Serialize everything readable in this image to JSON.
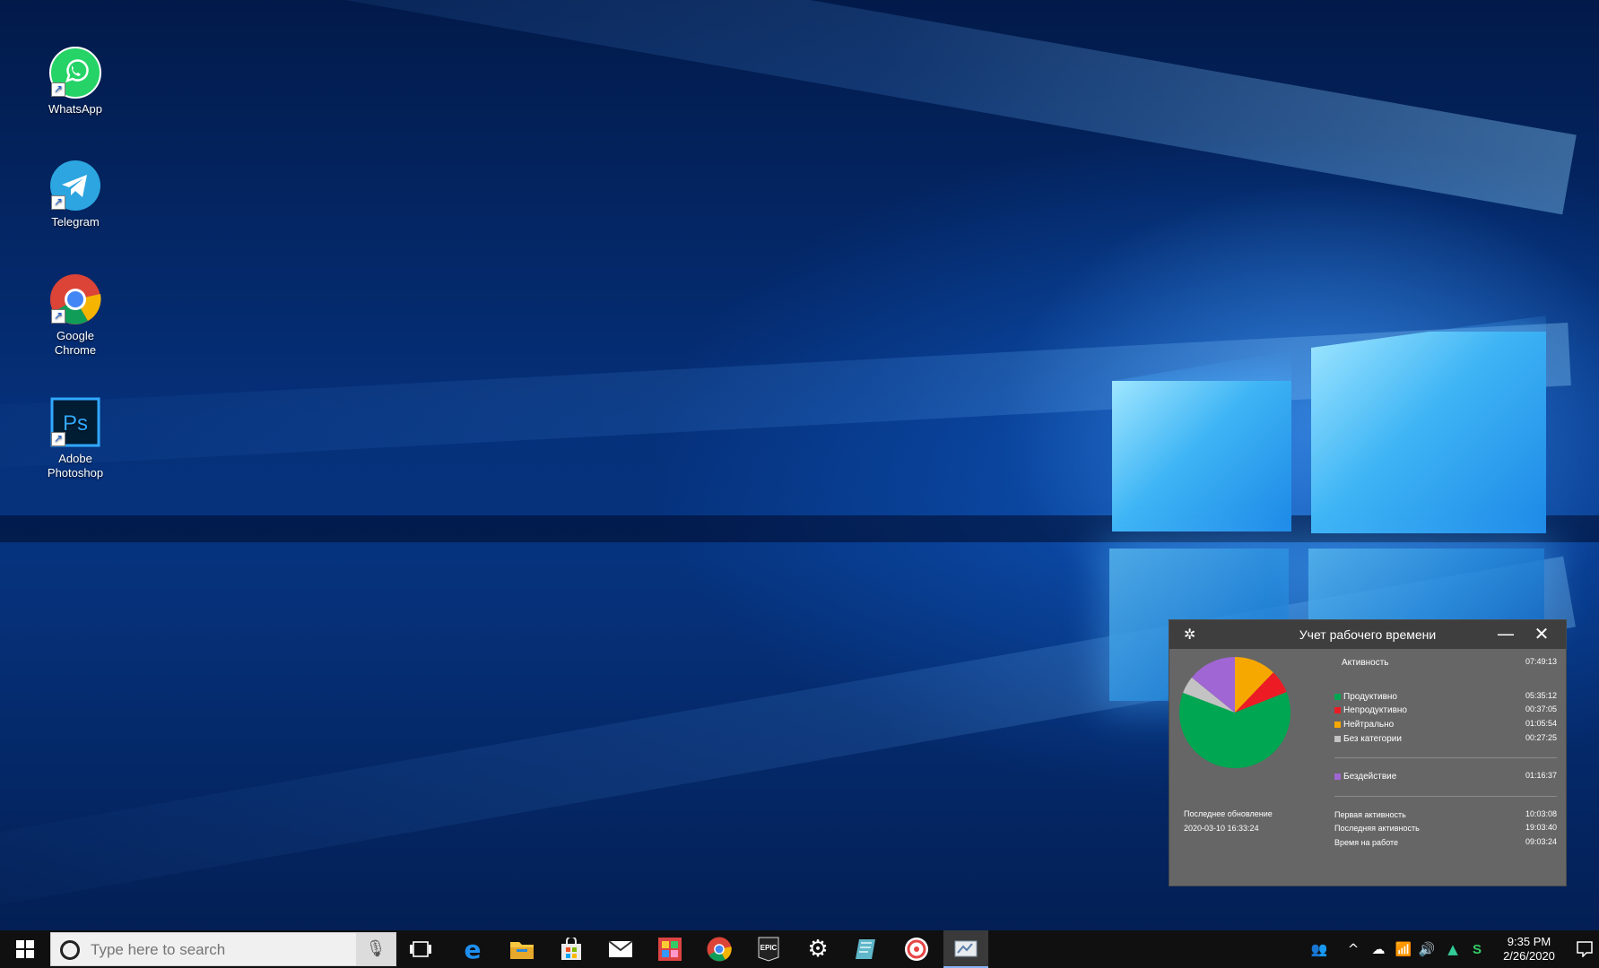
{
  "desktop": {
    "icons": [
      {
        "label": "WhatsApp"
      },
      {
        "label": "Telegram"
      },
      {
        "label": "Google\nChrome"
      },
      {
        "label": "Adobe\nPhotoshop"
      }
    ]
  },
  "widget": {
    "title": "Учет рабочего времени",
    "activity_label": "Активность",
    "activity_value": "07:49:13",
    "categories": [
      {
        "label": "Продуктивно",
        "value": "05:35:12",
        "color": "#00a651"
      },
      {
        "label": "Непродуктивно",
        "value": "00:37:05",
        "color": "#ed1c24"
      },
      {
        "label": "Нейтрально",
        "value": "01:05:54",
        "color": "#f7a800"
      },
      {
        "label": "Без категории",
        "value": "00:27:25",
        "color": "#c3c3c3"
      }
    ],
    "idle": {
      "label": "Бездействие",
      "value": "01:16:37",
      "color": "#a066d3"
    },
    "first_activity": {
      "label": "Первая активность",
      "value": "10:03:08"
    },
    "last_activity": {
      "label": "Последняя активность",
      "value": "19:03:40"
    },
    "time_at_work": {
      "label": "Время на работе",
      "value": "09:03:24"
    },
    "last_update_label": "Последнее обновление",
    "last_update_value": "2020-03-10 16:33:24"
  },
  "taskbar": {
    "search_placeholder": "Type here to search",
    "apps": [
      "task-view-icon",
      "edge-icon",
      "file-explorer-icon",
      "store-icon",
      "mail-icon",
      "game-icon",
      "chrome-icon",
      "epic-games-icon",
      "settings-icon",
      "notes-icon",
      "app-a-icon",
      "time-tracker-icon"
    ],
    "epic_label": "EPIC",
    "clock_time": "9:35 PM",
    "clock_date": "2/26/2020"
  }
}
